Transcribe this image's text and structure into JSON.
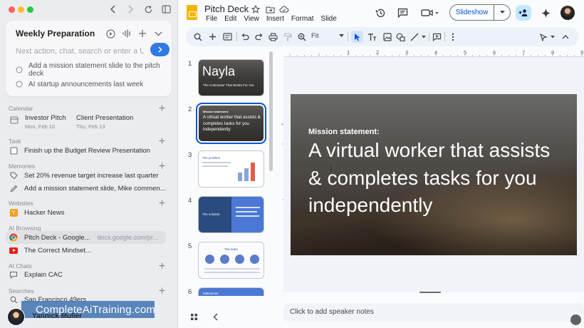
{
  "sidebar": {
    "space": {
      "title": "Weekly Preparation",
      "input_placeholder": "Next action, chat, search or enter a URL",
      "suggestions": [
        "Add a mission statement slide to the pitch deck",
        "AI startup announcements last week"
      ]
    },
    "calendar": {
      "label": "Calendar",
      "events": [
        {
          "title": "Investor Pitch",
          "date": "Mon, Feb 10"
        },
        {
          "title": "Client Presentation",
          "date": "Thu, Feb 13"
        }
      ]
    },
    "task": {
      "label": "Task",
      "items": [
        "Finish up the Budget Review Presentation"
      ]
    },
    "memories": {
      "label": "Memories",
      "items": [
        "Set 20% revenue target increase last quarter",
        "Add a mission statement slide, Mike commen..."
      ]
    },
    "websites": {
      "label": "Websites",
      "items": [
        "Hacker News"
      ]
    },
    "ai_browsing": {
      "label": "AI Browsing",
      "items": [
        {
          "title": "Pitch Deck - Google...",
          "url": "docs.google.com/pr..."
        },
        {
          "title": "The Correct Mindset..."
        }
      ]
    },
    "ai_chats": {
      "label": "AI Chats",
      "items": [
        "Explain CAC"
      ]
    },
    "searches": {
      "label": "Searches",
      "items": [
        "San Francisco 49ers"
      ]
    },
    "user": {
      "name": "Yannick Muller"
    },
    "watermark": "CompleteAiTraining.com"
  },
  "app": {
    "title": "Pitch Deck",
    "menus": [
      "File",
      "Edit",
      "View",
      "Insert",
      "Format",
      "Slide"
    ],
    "slideshow_label": "Slideshow",
    "zoom": "Fit",
    "filmstrip": [
      {
        "num": "1",
        "title": "Nayla",
        "subtitle": "The AI Browser That Works For You"
      },
      {
        "num": "2",
        "text": "A virtual worker that assists & completes tasks for you independently"
      },
      {
        "num": "3",
        "title": "The problem"
      },
      {
        "num": "4",
        "title": "The solution"
      },
      {
        "num": "5",
        "title": "The team"
      },
      {
        "num": "6",
        "title": "Milestones"
      }
    ],
    "ruler_numbers": [
      "1",
      "1",
      "2",
      "3",
      "4",
      "5",
      "6",
      "7",
      "8",
      "9"
    ],
    "slide": {
      "kicker": "Mission statement:",
      "body": "A virtual worker that assists & completes tasks for you independently"
    },
    "notes_placeholder": "Click to add speaker notes"
  },
  "colors": {
    "accent_blue": "#0b57d0",
    "go_button": "#2f7ae5",
    "slides_yellow": "#f6b400",
    "share_bg": "#c2e7ff"
  },
  "icons": [
    "back-icon",
    "forward-icon",
    "reload-icon",
    "sidebar-toggle-icon",
    "play-icon",
    "voice-icon",
    "plus-icon",
    "chevron-down-icon",
    "sparkle-icon",
    "history-icon",
    "comment-icon",
    "video-icon",
    "add-person-icon",
    "gemini-icon",
    "search-icon",
    "undo-icon",
    "redo-icon",
    "print-icon",
    "paint-format-icon",
    "zoom-icon",
    "cursor-icon",
    "textbox-icon",
    "image-icon",
    "shape-icon",
    "line-icon",
    "add-comment-icon",
    "more-icon",
    "pen-icon",
    "collapse-icon",
    "grid-view-icon"
  ]
}
